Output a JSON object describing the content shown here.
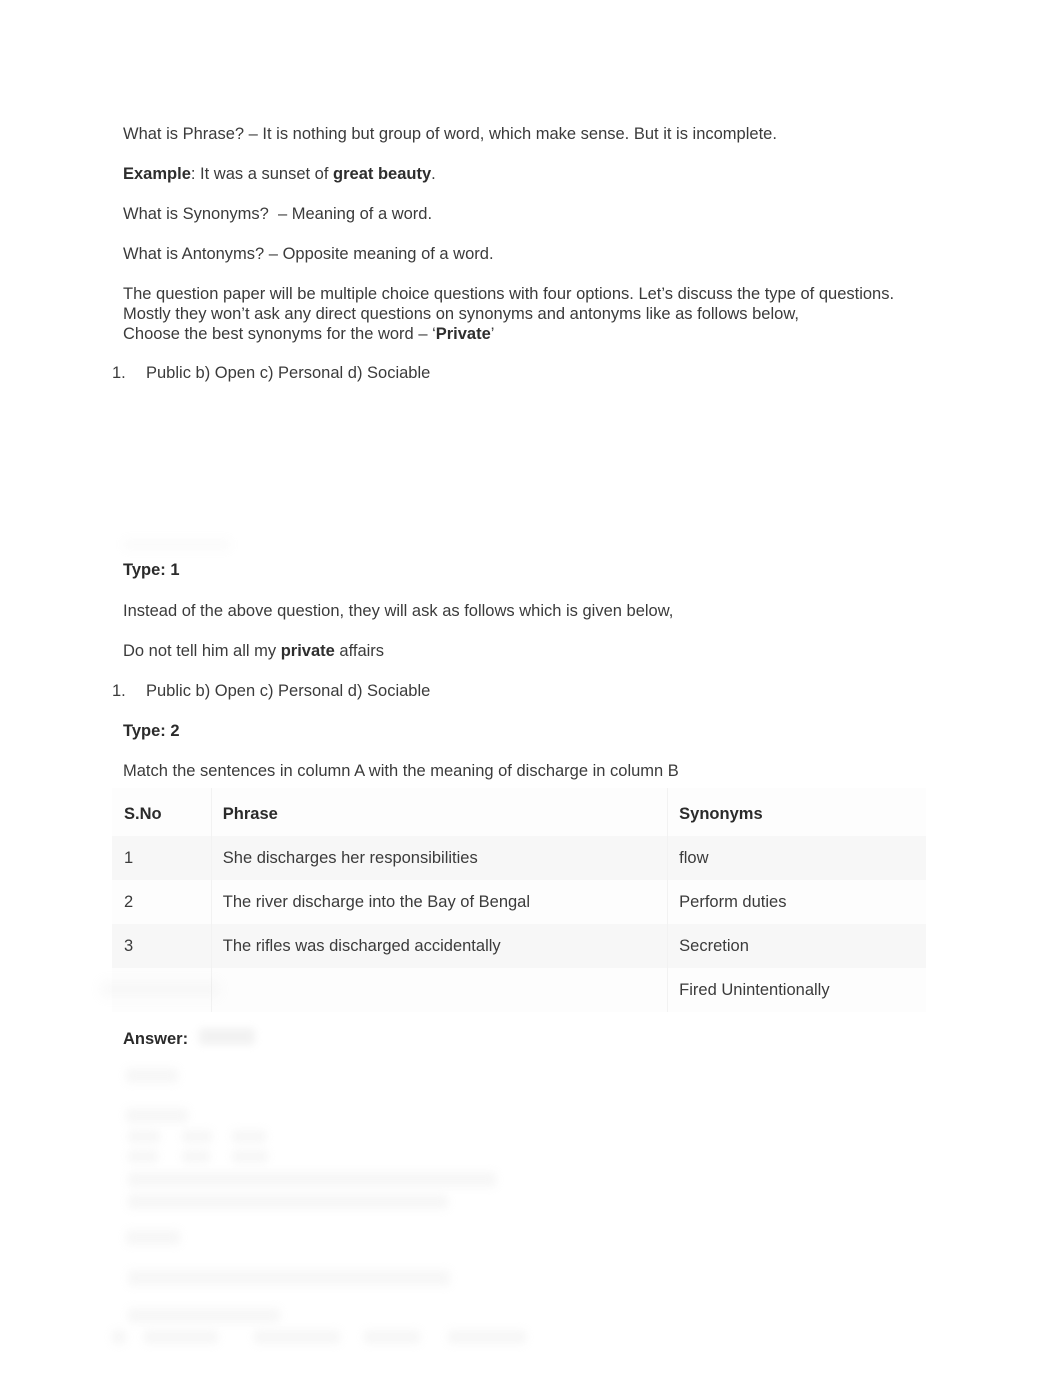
{
  "document": {
    "title": "Phrases, Synonyms and Antonyms - Study Notes",
    "background_color": "#ffffff",
    "text_color": "#3b3b3b"
  },
  "body": {
    "phrase_definition": "What is Phrase? – It is nothing but group of word, which make sense. But it is incomplete.",
    "example_label": "Example",
    "example_rest": ": It was a sunset of ",
    "example_bold": "great beauty",
    "example_end": ".",
    "synonyms_definition": "What is Synonyms?  – Meaning of a word.",
    "antonyms_definition": "What is Antonyms? – Opposite meaning of a word.",
    "intro_line1": "The question paper will be multiple choice questions with four options. Let’s discuss the type of questions.",
    "intro_line2": "Mostly they won’t ask any direct questions on synonyms and antonyms like as follows below,",
    "intro_line3_pre": "Choose the best synonyms for the word – ‘",
    "intro_line3_bold": "Private",
    "intro_line3_post": "’",
    "options_1": {
      "number": "1.",
      "text": "Public b) Open    c) Personal   d) Sociable"
    }
  },
  "type1": {
    "heading": "Type: 1",
    "instruction": "Instead of the above question, they will ask as follows which is given below,",
    "sentence_pre": "Do not tell him all my ",
    "sentence_bold": "private",
    "sentence_post": " affairs",
    "options": {
      "number": "1.",
      "text": "Public b) Open c) Personal      d) Sociable"
    }
  },
  "type2": {
    "heading": "Type: 2",
    "instruction": "Match the sentences in column A with the meaning of discharge in column B"
  },
  "table": {
    "headers": [
      "S.No",
      "Phrase",
      "Synonyms"
    ],
    "rows": [
      {
        "sno": "1",
        "phrase": "She discharges her responsibilities",
        "synonym": "flow"
      },
      {
        "sno": "2",
        "phrase": "The river discharge into the Bay of Bengal",
        "synonym": "Perform duties"
      },
      {
        "sno": "3",
        "phrase": "The rifles was discharged accidentally",
        "synonym": "Secretion"
      },
      {
        "sno": "",
        "phrase": "",
        "synonym": "Fired Unintentionally"
      }
    ]
  },
  "answer": {
    "label": "Answer:"
  }
}
